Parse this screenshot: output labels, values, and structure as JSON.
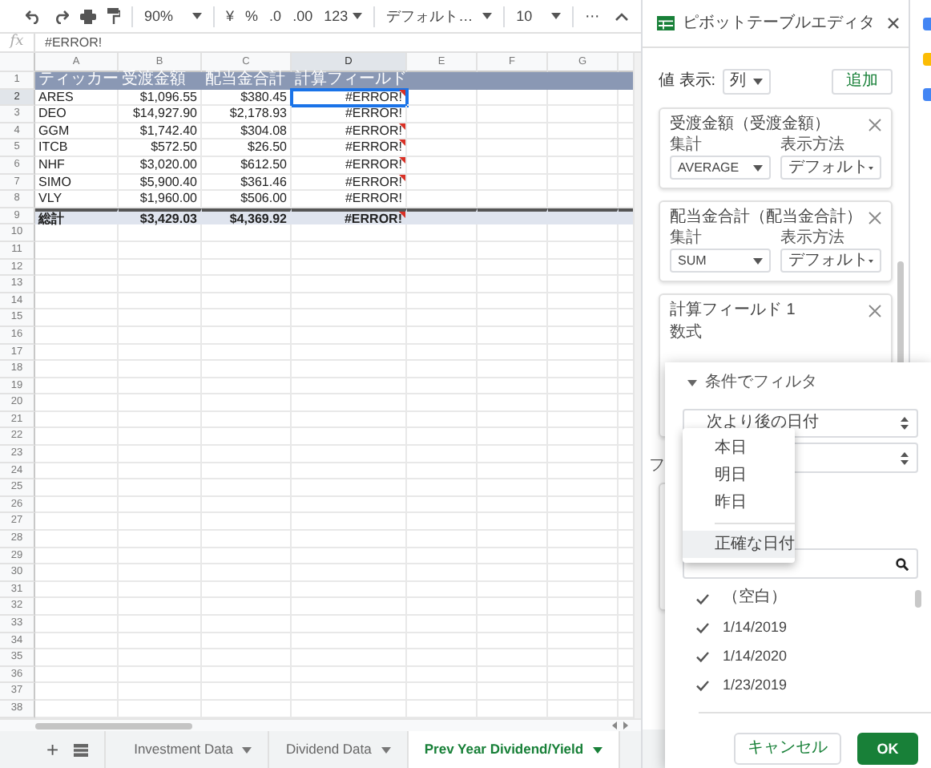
{
  "toolbar": {
    "zoom": "90%",
    "currency": "¥",
    "percent": "%",
    "decimal_decrease": ".0",
    "decimal_increase": ".00",
    "number_format": "123",
    "font": "デフォルト…",
    "font_size": "10",
    "more": "⋯"
  },
  "formula_bar": {
    "label": "fx",
    "value": "#ERROR!"
  },
  "sheet": {
    "columns": [
      {
        "label": "A",
        "selected": false
      },
      {
        "label": "B",
        "selected": false
      },
      {
        "label": "C",
        "selected": false
      },
      {
        "label": "D",
        "selected": true
      },
      {
        "label": "E",
        "selected": false
      },
      {
        "label": "F",
        "selected": false
      },
      {
        "label": "G",
        "selected": false
      }
    ],
    "header": {
      "number": "1",
      "cells": [
        "ティッカー",
        "受渡金額",
        "配当金合計",
        "計算フィールド"
      ]
    },
    "rows": [
      {
        "number": "2",
        "selected": true,
        "error_flag": true,
        "cells": [
          "ARES",
          "$1,096.55",
          "$380.45",
          "#ERROR!"
        ]
      },
      {
        "number": "3",
        "selected": false,
        "error_flag": false,
        "cells": [
          "DEO",
          "$14,927.90",
          "$2,178.93",
          "#ERROR!"
        ]
      },
      {
        "number": "4",
        "selected": false,
        "error_flag": true,
        "cells": [
          "GGM",
          "$1,742.40",
          "$304.08",
          "#ERROR!"
        ]
      },
      {
        "number": "5",
        "selected": false,
        "error_flag": true,
        "cells": [
          "ITCB",
          "$572.50",
          "$26.50",
          "#ERROR!"
        ]
      },
      {
        "number": "6",
        "selected": false,
        "error_flag": true,
        "cells": [
          "NHF",
          "$3,020.00",
          "$612.50",
          "#ERROR!"
        ]
      },
      {
        "number": "7",
        "selected": false,
        "error_flag": true,
        "cells": [
          "SIMO",
          "$5,900.40",
          "$361.46",
          "#ERROR!"
        ]
      },
      {
        "number": "8",
        "selected": false,
        "error_flag": false,
        "cells": [
          "VLY",
          "$1,960.00",
          "$506.00",
          "#ERROR!"
        ]
      }
    ],
    "total": {
      "number": "9",
      "error_flag": true,
      "cells": [
        "総計",
        "$3,429.03",
        "$4,369.92",
        "#ERROR!"
      ]
    },
    "empty_rows": [
      "10",
      "11",
      "12",
      "13",
      "14",
      "15",
      "16",
      "17",
      "18",
      "19",
      "20",
      "21",
      "22",
      "23",
      "24",
      "25",
      "26",
      "27",
      "28",
      "29",
      "30",
      "31",
      "32",
      "33",
      "34",
      "35",
      "36",
      "37",
      "38"
    ]
  },
  "sheet_tabs": {
    "add": "+",
    "tabs": [
      {
        "label": "Investment Data",
        "selected": false
      },
      {
        "label": "Dividend Data",
        "selected": false
      },
      {
        "label": "Prev Year Dividend/Yield",
        "selected": true
      }
    ]
  },
  "pivot_editor": {
    "title": "ピボットテーブルエディタ",
    "values_label": "値 表示:",
    "values_layout": "列",
    "add_button": "追加",
    "value_cards": [
      {
        "title": "受渡金額（受渡金額）",
        "summarize_label": "集計",
        "summarize": "AVERAGE",
        "show_as_label": "表示方法",
        "show_as": "デフォルト"
      },
      {
        "title": "配当金合計（配当金合計）",
        "summarize_label": "集計",
        "summarize": "SUM",
        "show_as_label": "表示方法",
        "show_as": "デフォルト"
      }
    ],
    "calculated_field": {
      "title": "計算フィールド 1",
      "formula_label": "数式"
    },
    "section_label": "フ"
  },
  "filter_popup": {
    "heading": "条件でフィルタ",
    "condition": "次より後の日付",
    "condition_menu": [
      {
        "kind": "option",
        "label": "本日",
        "selected": false
      },
      {
        "kind": "option",
        "label": "明日",
        "selected": false
      },
      {
        "kind": "option",
        "label": "昨日",
        "selected": false
      },
      {
        "kind": "divider"
      },
      {
        "kind": "option",
        "label": "正確な日付",
        "selected": true
      }
    ],
    "values": [
      {
        "label": "（空白）",
        "checked": true
      },
      {
        "label": "1/14/2019",
        "checked": true
      },
      {
        "label": "1/14/2020",
        "checked": true
      },
      {
        "label": "1/23/2019",
        "checked": true
      }
    ],
    "cancel": "キャンセル",
    "ok": "OK"
  },
  "side_panel_icons": [
    {
      "color": "#4285f4"
    },
    {
      "color": "#fbbc04"
    },
    {
      "color": "#4285f4"
    }
  ]
}
